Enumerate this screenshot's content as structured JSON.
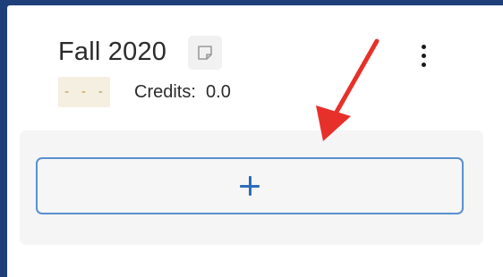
{
  "semester": {
    "title": "Fall 2020",
    "gpa_badge": "- - -",
    "credits_text": "Credits:  0.0"
  },
  "icons": {
    "note": "note-icon",
    "more": "more-vertical-icon",
    "add": "plus-icon",
    "annotation": "arrow-annotation"
  },
  "colors": {
    "frame_border": "#1f3f7a",
    "accent_blue": "#2c6cb8",
    "button_border": "#5a90cf",
    "badge_bg": "#f4efe0",
    "badge_text": "#b79a37",
    "annotation_arrow": "#e8302a"
  }
}
